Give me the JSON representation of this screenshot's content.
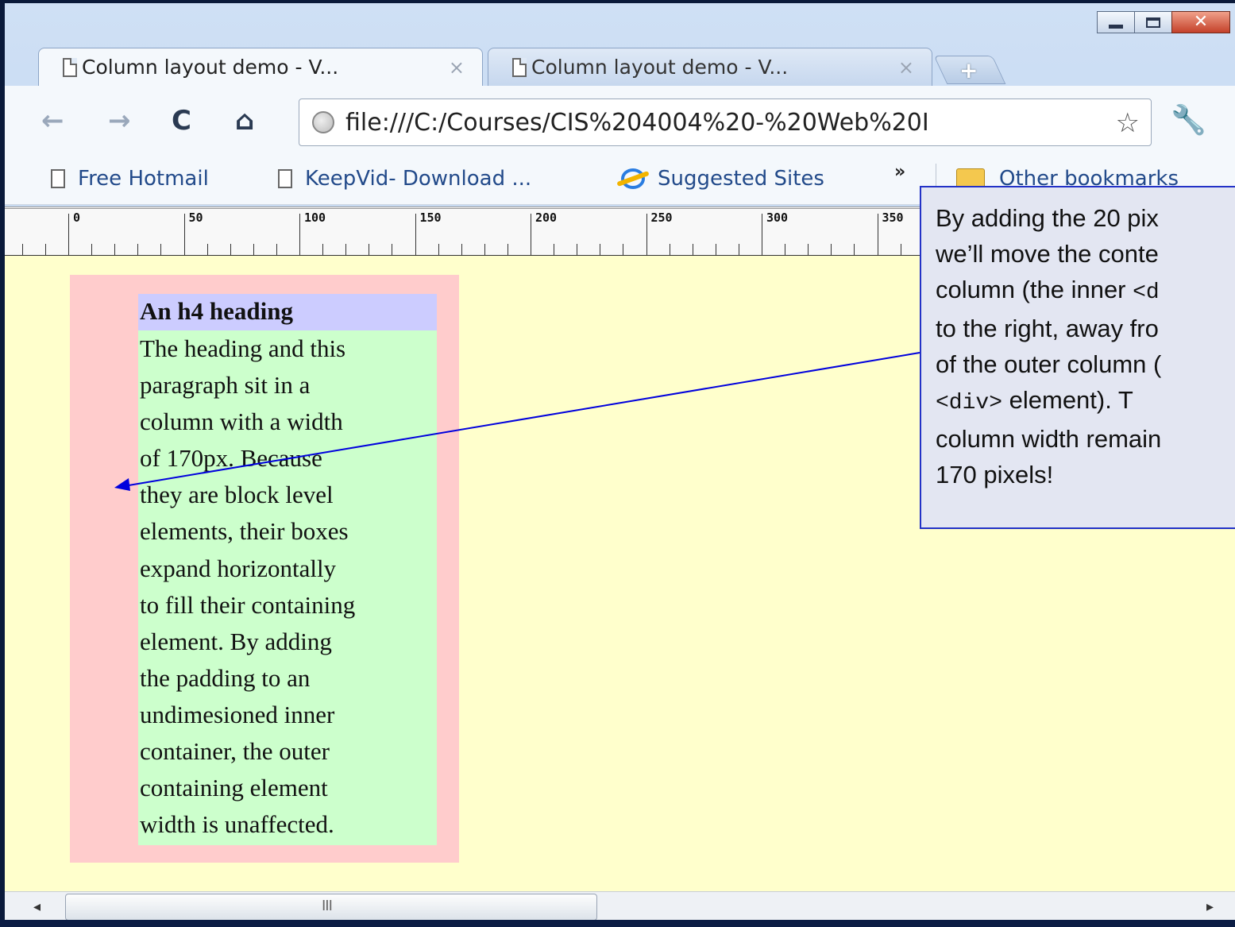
{
  "tabs": [
    {
      "label": "Column layout demo - V...",
      "active": true
    },
    {
      "label": "Column layout demo - V...",
      "active": false
    }
  ],
  "tab_close_glyph": "×",
  "new_tab_glyph": "+",
  "window_controls": {
    "close_glyph": "✕"
  },
  "nav": {
    "back": "←",
    "forward": "→",
    "reload": "C",
    "home": "⌂"
  },
  "address": {
    "url": "file:///C:/Courses/CIS%204004%20-%20Web%20I"
  },
  "bookmarks": {
    "items": [
      {
        "label": "Free Hotmail",
        "icon": "page-icon"
      },
      {
        "label": "KeepVid- Download ...",
        "icon": "page-icon"
      },
      {
        "label": "Suggested Sites",
        "icon": "ie-icon"
      }
    ],
    "overflow_glyph": "»",
    "other": "Other bookmarks"
  },
  "ruler": {
    "labels": [
      "0",
      "50",
      "100",
      "150",
      "200",
      "250",
      "300",
      "350"
    ]
  },
  "content": {
    "heading": "An h4 heading",
    "paragraph_lines": [
      "The heading and this",
      "paragraph sit in a",
      "column with a width",
      "of 170px. Because",
      "they are block level",
      "elements, their boxes",
      "expand horizontally",
      "to fill their containing",
      "element. By adding",
      "the padding to an",
      "undimesioned inner",
      "container, the outer",
      "containing element",
      "width is unaffected."
    ]
  },
  "callout": {
    "line1": "By adding the 20 pix",
    "line2": "we’ll move the conte",
    "line3_text": "column (the inner ",
    "line3_code": "<d",
    "line4": "to the right, away fro",
    "line5": "of the outer column (",
    "line6_code": "<div>",
    "line6_text": " element).  T",
    "line7": "column width remain",
    "line8": "170 pixels!"
  },
  "scrollbar": {
    "left_arrow": "◂",
    "right_arrow": "▸",
    "grip": "III"
  },
  "colors": {
    "viewport_bg": "#ffffcc",
    "outer_column": "#ffcccc",
    "inner_column": "#ccffcc",
    "heading_bg": "#ccccff",
    "callout_border": "#2332c7",
    "arrow": "#0000dd"
  }
}
